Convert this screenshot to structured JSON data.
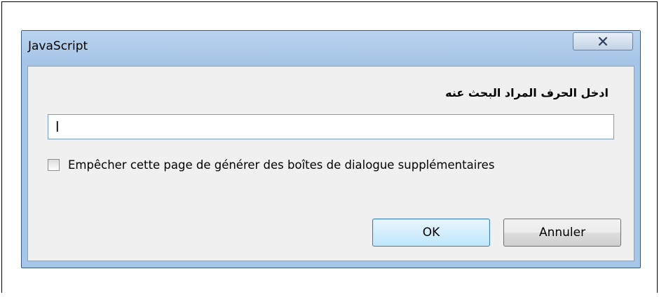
{
  "dialog": {
    "title": "JavaScript",
    "close_icon": "close-x-icon",
    "prompt": "ادخل الحرف المراد البحث عنه",
    "input_value": "ا",
    "checkbox_label": "Empêcher cette page de générer des boîtes de dialogue supplémentaires",
    "checkbox_checked": false,
    "ok_label": "OK",
    "cancel_label": "Annuler"
  },
  "colors": {
    "titlebar": "#a6c6e8",
    "client_background": "#f0f0f0",
    "ok_border": "#3c7fb1"
  }
}
